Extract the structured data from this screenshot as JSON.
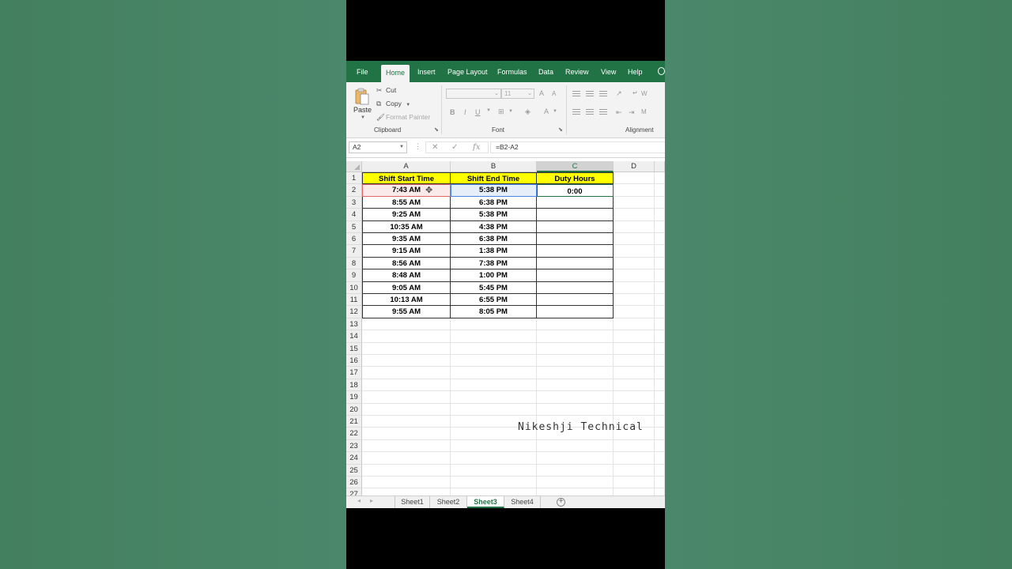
{
  "ribbon_tabs": [
    "File",
    "Home",
    "Insert",
    "Page Layout",
    "Formulas",
    "Data",
    "Review",
    "View",
    "Help"
  ],
  "active_tab": "Home",
  "clipboard": {
    "paste_label": "Paste",
    "cut_label": "Cut",
    "copy_label": "Copy",
    "format_painter_label": "Format Painter",
    "group_label": "Clipboard"
  },
  "font_group": {
    "font_size": "11",
    "bold": "B",
    "italic": "I",
    "underline": "U",
    "font_color": "A",
    "grow": "A",
    "shrink": "A",
    "group_label": "Font"
  },
  "alignment_group": {
    "wrap_text_partial": "W",
    "merge_partial": "M",
    "group_label": "Alignment"
  },
  "formula_bar": {
    "name_box": "A2",
    "fx": "fx",
    "formula": "=B2-A2"
  },
  "columns": [
    "A",
    "B",
    "C",
    "D"
  ],
  "selected_column": "C",
  "row_numbers": [
    "1",
    "2",
    "3",
    "4",
    "5",
    "6",
    "7",
    "8",
    "9",
    "10",
    "11",
    "12",
    "13",
    "14",
    "15",
    "16",
    "17",
    "18",
    "19",
    "20",
    "21",
    "22",
    "23",
    "24",
    "25",
    "26",
    "27"
  ],
  "table": {
    "headers": [
      "Shift Start Time",
      "Shift End Time",
      "Duty Hours"
    ],
    "rows": [
      [
        "7:43 AM",
        "5:38 PM",
        "0:00"
      ],
      [
        "8:55 AM",
        "6:38 PM",
        ""
      ],
      [
        "9:25 AM",
        "5:38 PM",
        ""
      ],
      [
        "10:35 AM",
        "4:38 PM",
        ""
      ],
      [
        "9:35 AM",
        "6:38 PM",
        ""
      ],
      [
        "9:15 AM",
        "1:38 PM",
        ""
      ],
      [
        "8:56 AM",
        "7:38 PM",
        ""
      ],
      [
        "8:48 AM",
        "1:00 PM",
        ""
      ],
      [
        "9:05 AM",
        "5:45 PM",
        ""
      ],
      [
        "10:13 AM",
        "6:55 PM",
        ""
      ],
      [
        "9:55 AM",
        "8:05 PM",
        ""
      ]
    ]
  },
  "watermark": "Nikeshji Technical",
  "sheets": [
    "Sheet1",
    "Sheet2",
    "Sheet3",
    "Sheet4"
  ],
  "active_sheet": "Sheet3",
  "colors": {
    "excel_green": "#217346",
    "header_fill": "#ffff00",
    "background": "#4b8468"
  }
}
